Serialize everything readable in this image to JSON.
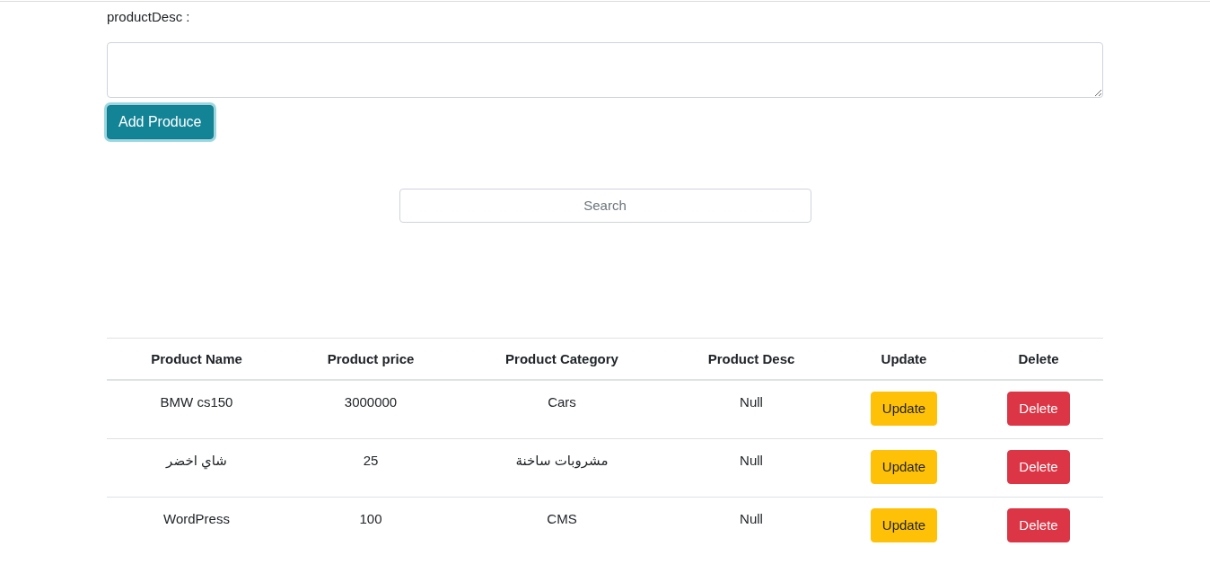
{
  "form": {
    "label": "productDesc :",
    "submit_button": {
      "label": "Add Produce",
      "focused": true
    }
  },
  "search": {
    "placeholder": "Search"
  },
  "table": {
    "columns": [
      "Product Name",
      "Product price",
      "Product Category",
      "Product Desc",
      "Update",
      "Delete"
    ],
    "rows": [
      {
        "cells": [
          "BMW cs150",
          "3000000",
          "Cars",
          "Null"
        ],
        "update_button": "Update",
        "delete_button": "Delete"
      },
      {
        "cells": [
          "شاي اخضر",
          "25",
          "مشروبات ساخنة",
          "Null"
        ],
        "update_button": "Update",
        "delete_button": "Delete"
      },
      {
        "cells": [
          "WordPress",
          "100",
          "CMS",
          "Null"
        ],
        "update_button": "Update",
        "delete_button": "Delete"
      }
    ]
  }
}
